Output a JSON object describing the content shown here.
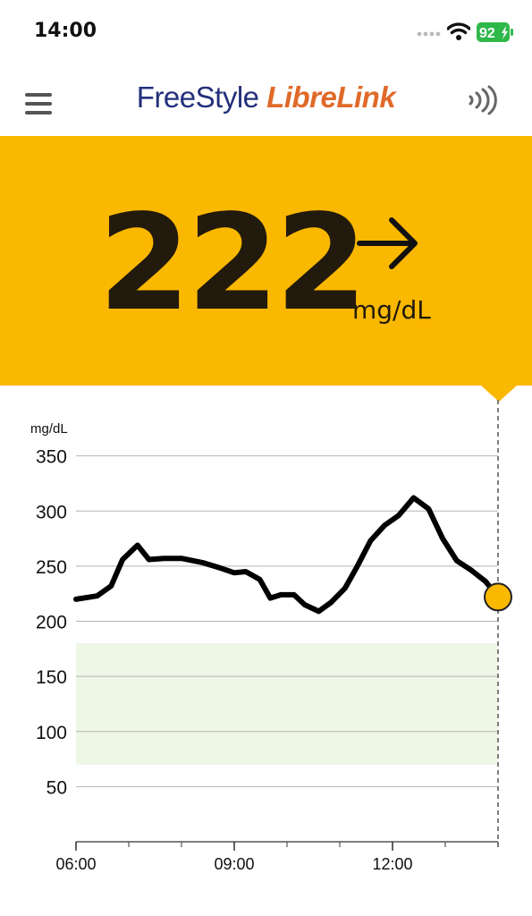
{
  "status_bar": {
    "time": "14:00",
    "battery": "92",
    "battery_color": "#2fb84a"
  },
  "header": {
    "logo_part1": "FreeStyle ",
    "logo_part2": "LibreLink",
    "logo_color1": "#23307a",
    "logo_color2": "#e06a29",
    "menu_icon": "hamburger-menu-icon",
    "scan_icon": "nfc-scan-icon"
  },
  "reading": {
    "value": "222",
    "unit": "mg/dL",
    "trend_icon": "arrow-right-icon",
    "background_color": "#fbb800"
  },
  "chart_data": {
    "type": "line",
    "y_unit_label": "mg/dL",
    "y_ticks": [
      350,
      300,
      250,
      200,
      150,
      100,
      50
    ],
    "y_tick_labels": [
      "350",
      "300",
      "250",
      "200",
      "150",
      "100",
      "50"
    ],
    "x_tick_labels": [
      "06:00",
      "09:00",
      "12:00"
    ],
    "ylim": [
      0,
      375
    ],
    "xlim": [
      "06:00",
      "14:00"
    ],
    "target_range": [
      70,
      180
    ],
    "target_range_color": "#eef6e6",
    "line_color": "#000000",
    "current_point_color": "#fbb800",
    "series": [
      {
        "points": [
          [
            "06:00",
            220
          ],
          [
            "06:24",
            223
          ],
          [
            "06:40",
            232
          ],
          [
            "06:53",
            256
          ],
          [
            "07:10",
            269
          ],
          [
            "07:23",
            256
          ],
          [
            "07:40",
            257
          ],
          [
            "08:00",
            257
          ],
          [
            "08:25",
            253
          ],
          [
            "08:45",
            248
          ],
          [
            "09:00",
            244
          ],
          [
            "09:13",
            245
          ],
          [
            "09:29",
            238
          ],
          [
            "09:41",
            221
          ],
          [
            "09:53",
            224
          ],
          [
            "10:08",
            224
          ],
          [
            "10:20",
            215
          ],
          [
            "10:36",
            209
          ],
          [
            "10:50",
            217
          ],
          [
            "11:06",
            230
          ],
          [
            "11:20",
            250
          ],
          [
            "11:35",
            273
          ],
          [
            "11:51",
            287
          ],
          [
            "12:07",
            296
          ],
          [
            "12:24",
            312
          ],
          [
            "12:41",
            302
          ],
          [
            "12:57",
            275
          ],
          [
            "13:13",
            255
          ],
          [
            "13:30",
            246
          ],
          [
            "13:46",
            236
          ],
          [
            "14:00",
            222
          ]
        ]
      }
    ]
  }
}
